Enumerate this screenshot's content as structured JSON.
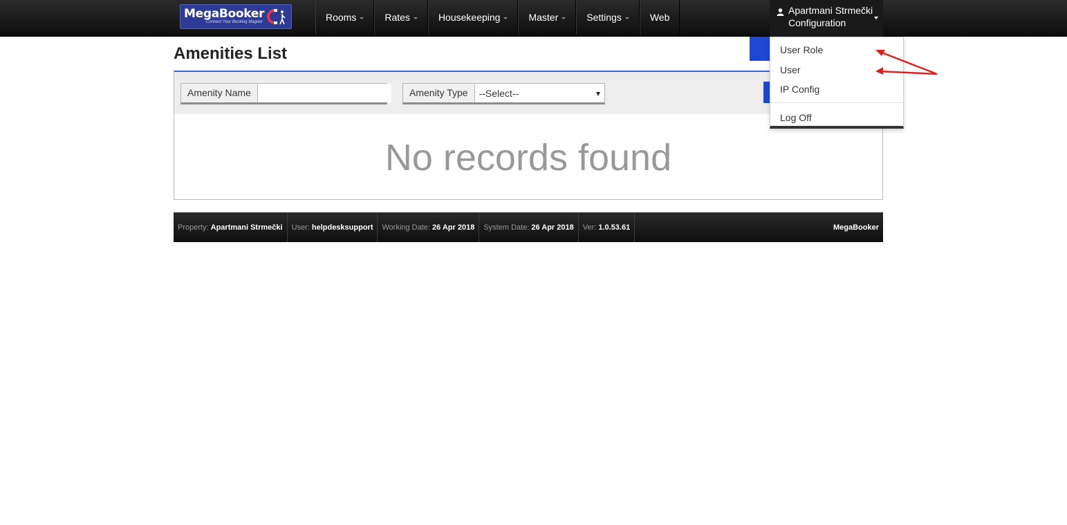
{
  "navbar": {
    "logo_text": "MegaBooker",
    "logo_tagline": "Connect Your Booking Magnet",
    "items": [
      {
        "label": "Rooms",
        "has_caret": true
      },
      {
        "label": "Rates",
        "has_caret": true
      },
      {
        "label": "Housekeeping",
        "has_caret": true
      },
      {
        "label": "Master",
        "has_caret": true
      },
      {
        "label": "Settings",
        "has_caret": true
      },
      {
        "label": "Web",
        "has_caret": false
      }
    ],
    "user_menu": {
      "property_name": "Apartmani Strmečki",
      "section": "Configuration",
      "icon": "user-icon"
    }
  },
  "dropdown": {
    "items": [
      "User Role",
      "User",
      "IP Config"
    ],
    "logoff_label": "Log Off"
  },
  "page": {
    "title": "Amenities List"
  },
  "filters": {
    "amenity_name_label": "Amenity Name",
    "amenity_name_value": "",
    "amenity_type_label": "Amenity Type",
    "amenity_type_selected": "--Select--"
  },
  "results": {
    "empty_message": "No records found"
  },
  "footer": {
    "property_label": "Property:",
    "property_value": "Apartmani Strmečki",
    "user_label": "User:",
    "user_value": "helpdesksupport",
    "working_date_label": "Working Date:",
    "working_date_value": "26 Apr 2018",
    "system_date_label": "System Date:",
    "system_date_value": "26 Apr 2018",
    "version_label": "Ver:",
    "version_value": "1.0.53.61",
    "brand": "MegaBooker"
  },
  "colors": {
    "accent_blue": "#1f47d6",
    "panel_top_border": "#3c66d4",
    "annotation_arrow": "#e02020",
    "navbar_bg": "#1a1a1a",
    "logo_bg": "#2d3b96"
  }
}
